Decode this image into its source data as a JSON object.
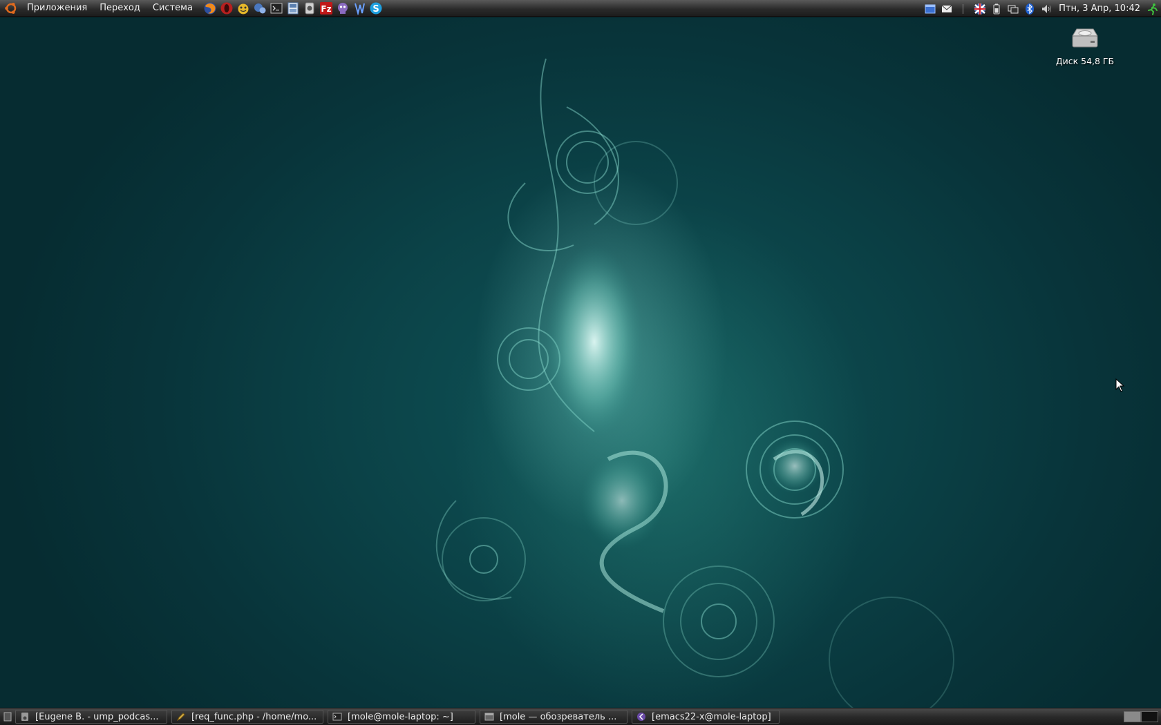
{
  "top_panel": {
    "menus": [
      {
        "label": "Приложения"
      },
      {
        "label": "Переход"
      },
      {
        "label": "Система"
      }
    ],
    "launchers": [
      {
        "icon": "firefox-icon",
        "color": "#e8761c"
      },
      {
        "icon": "opera-icon",
        "color": "#c02020"
      },
      {
        "icon": "evolution-icon",
        "color": "#e0b020"
      },
      {
        "icon": "pidgin-icon",
        "color": "#4a78c0"
      },
      {
        "icon": "terminal-icon",
        "color": "#303030"
      },
      {
        "icon": "file-manager-icon",
        "color": "#5a7fb0"
      },
      {
        "icon": "disk-utility-icon",
        "color": "#c0c0c0"
      },
      {
        "icon": "filezilla-icon",
        "color": "#c01818"
      },
      {
        "icon": "messenger-icon",
        "color": "#8a6ac0"
      },
      {
        "icon": "tweak-icon",
        "color": "#3a7ad0"
      },
      {
        "icon": "skype-icon",
        "color": "#1ea0e0"
      }
    ],
    "tray": [
      {
        "icon": "window-list-icon"
      },
      {
        "icon": "mail-icon"
      },
      {
        "icon": "flag-uk-icon"
      },
      {
        "icon": "battery-icon"
      },
      {
        "icon": "network-icon"
      },
      {
        "icon": "bluetooth-icon"
      },
      {
        "icon": "volume-icon"
      }
    ],
    "clock": "Птн, 3 Апр, 10:42",
    "logout_icon": "logout-runner-icon"
  },
  "desktop": {
    "icons": [
      {
        "label": "Диск 54,8 ГБ",
        "icon": "hard-disk-icon"
      }
    ]
  },
  "taskbar": {
    "tasks": [
      {
        "label": "[Eugene B. - ump_podcas...",
        "icon": "audio-player-icon"
      },
      {
        "label": "[req_func.php - /home/mo...",
        "icon": "text-editor-icon"
      },
      {
        "label": "[mole@mole-laptop: ~]",
        "icon": "terminal-icon"
      },
      {
        "label": "[mole — обозреватель ...",
        "icon": "file-browser-icon"
      },
      {
        "label": "[emacs22-x@mole-laptop]",
        "icon": "emacs-icon"
      }
    ],
    "workspaces": [
      {
        "active": true
      },
      {
        "active": false
      }
    ]
  }
}
